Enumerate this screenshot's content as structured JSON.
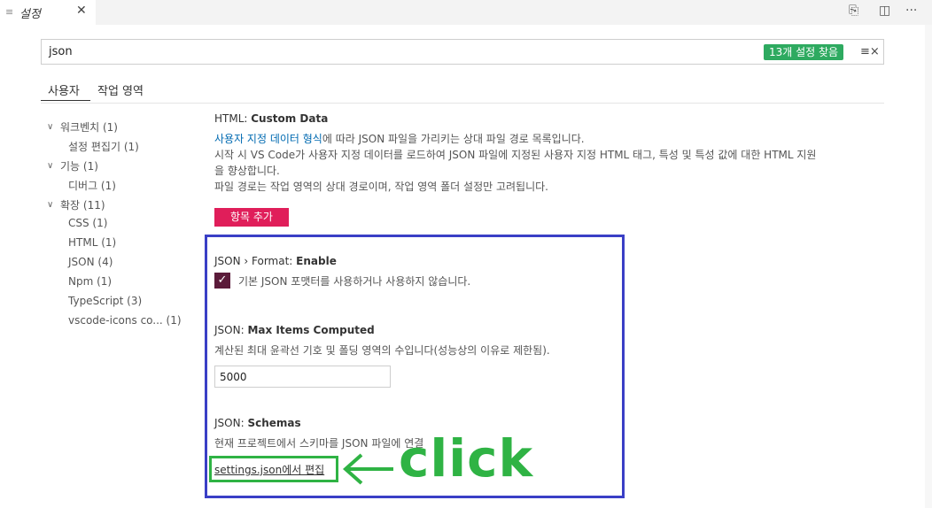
{
  "tab": {
    "title": "설정",
    "close": "✕"
  },
  "top_icons": {
    "open_json": "⎘",
    "split": "◫",
    "more": "···"
  },
  "search": {
    "value": "json",
    "found_badge": "13개 설정 찾음",
    "clear_icon": "≡×"
  },
  "scope_tabs": [
    "사용자",
    "작업 영역"
  ],
  "tree": [
    {
      "label": "워크벤치 (1)",
      "caret": "∨"
    },
    {
      "label": "설정 편집기 (1)"
    },
    {
      "label": "기능 (1)",
      "caret": "∨"
    },
    {
      "label": "디버그 (1)"
    },
    {
      "label": "확장 (11)",
      "caret": "∨"
    },
    {
      "label": "CSS (1)"
    },
    {
      "label": "HTML (1)"
    },
    {
      "label": "JSON (4)"
    },
    {
      "label": "Npm (1)"
    },
    {
      "label": "TypeScript (3)"
    },
    {
      "label": "vscode-icons co...  (1)"
    }
  ],
  "html_custom_data": {
    "title_prefix": "HTML: ",
    "title_bold": "Custom Data",
    "desc_link": "사용자 지정 데이터 형식",
    "desc_line1_rest": "에 따라 JSON 파일을 가리키는 상대 파일 경로 목록입니다.",
    "desc_line2": "시작 시 VS Code가 사용자 지정 데이터를 로드하여 JSON 파일에 지정된 사용자 지정 HTML 태그, 특성 및 특성 값에 대한 HTML 지원",
    "desc_line3": "을 향상합니다.",
    "desc_line4": "파일 경로는 작업 영역의 상대 경로이며, 작업 영역 폴더 설정만 고려됩니다.",
    "add_button": "항목 추가"
  },
  "format_enable": {
    "title_prefix": "JSON › Format: ",
    "title_bold": "Enable",
    "checkbox_label": "기본 JSON 포맷터를 사용하거나 사용하지 않습니다.",
    "checked": true
  },
  "max_items": {
    "title_prefix": "JSON: ",
    "title_bold": "Max Items Computed",
    "desc": "계산된 최대 윤곽선 기호 및 폴딩 영역의 수입니다(성능상의 이유로 제한됨).",
    "value": "5000"
  },
  "schemas": {
    "title_prefix": "JSON: ",
    "title_bold": "Schemas",
    "desc": "현재 프로젝트에서 스키마를 JSON 파일에 연결",
    "edit_link": "settings.json에서 편집"
  },
  "annotation": {
    "click_text": "click",
    "arrow_color": "#2fb344",
    "box_color": "#3a3fc6"
  }
}
